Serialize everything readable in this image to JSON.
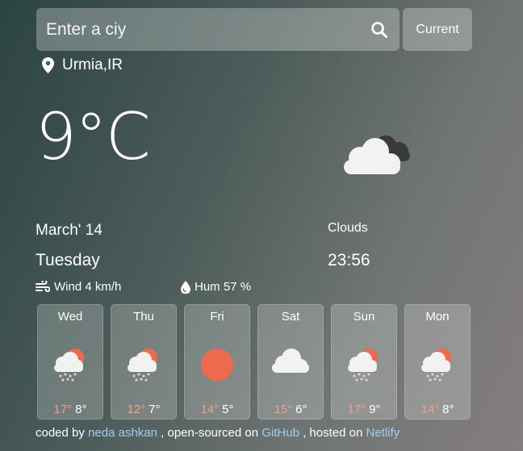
{
  "search": {
    "placeholder": "Enter a ciy",
    "current_label": "Current"
  },
  "location": {
    "name": "Urmia,IR"
  },
  "current": {
    "temperature": "9°C",
    "date": "March' 14",
    "day": "Tuesday",
    "description": "Clouds",
    "time": "23:56",
    "icon": "clouds-icon"
  },
  "stats": {
    "wind": "Wind 4 km/h",
    "humidity": "Hum 57 %"
  },
  "forecast": [
    {
      "day": "Wed",
      "high": "17°",
      "low": "8°",
      "icon": "sun-cloud-rain-icon"
    },
    {
      "day": "Thu",
      "high": "12°",
      "low": "7°",
      "icon": "sun-cloud-rain-icon"
    },
    {
      "day": "Fri",
      "high": "14°",
      "low": "5°",
      "icon": "sun-icon"
    },
    {
      "day": "Sat",
      "high": "15°",
      "low": "6°",
      "icon": "cloud-icon"
    },
    {
      "day": "Sun",
      "high": "17°",
      "low": "9°",
      "icon": "sun-cloud-rain-icon"
    },
    {
      "day": "Mon",
      "high": "14°",
      "low": "8°",
      "icon": "sun-cloud-rain-icon"
    }
  ],
  "footer": {
    "coded_by": "coded by",
    "author": "neda ashkan",
    "open_sourced": ", open-sourced on",
    "github": "GitHub",
    "hosted": ", hosted on",
    "netlify": "Netlify"
  },
  "colors": {
    "high_temp": "#e7a488",
    "link": "#9fd0f2",
    "sun": "#ee6a4e"
  }
}
